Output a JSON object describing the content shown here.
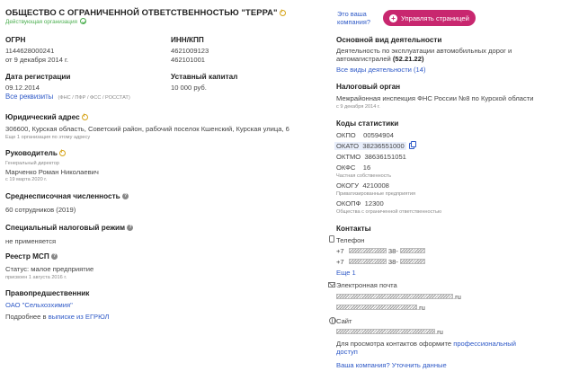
{
  "header": {
    "company_title": "ОБЩЕСТВО С ОГРАНИЧЕННОЙ ОТВЕТСТВЕННОСТЬЮ \"ТЕРРА\"",
    "status": "Действующая организация",
    "your_company_q": "Это ваша компания?",
    "manage_btn": "Управлять страницей"
  },
  "left": {
    "ogrn": {
      "label": "ОГРН",
      "value": "1144628000241",
      "sub": "от 9 декабря 2014 г."
    },
    "inn": {
      "label": "ИНН/КПП",
      "value1": "4621009123",
      "value2": "462101001"
    },
    "reg": {
      "label": "Дата регистрации",
      "value": "09.12.2014",
      "link": "Все реквизиты",
      "sub": "(ФНС / ПФР / ФСС / РОССТАТ)"
    },
    "capital": {
      "label": "Уставный капитал",
      "value": "10 000 руб."
    },
    "address": {
      "label": "Юридический адрес",
      "value": "306600, Курская область, Советский район, рабочий поселок Кшенский, Курская улица, 6",
      "sub": "Еще 1 организация по этому адресу"
    },
    "director": {
      "label": "Руководитель",
      "role": "Генеральный директор",
      "name": "Марченко Роман Николаевич",
      "since": "с 19 марта 2020 г."
    },
    "staff": {
      "label": "Среднесписочная численность",
      "value": "60 сотрудников (2019)"
    },
    "tax_regime": {
      "label": "Специальный налоговый режим",
      "value": "не применяется"
    },
    "msp": {
      "label": "Реестр МСП",
      "value": "Статус: малое предприятие",
      "sub": "присвоен 1 августа 2016 г."
    },
    "predecessor": {
      "label": "Правопредшественник",
      "value": "ОАО \"Сельхозхимия\"",
      "more_prefix": "Подробнее в",
      "more_link": "выписке из ЕГРЮЛ"
    }
  },
  "right": {
    "activity": {
      "label": "Основной вид деятельности",
      "value": "Деятельность по эксплуатации автомобильных дорог и автомагистралей",
      "code": "(52.21.22)",
      "link": "Все виды деятельности (14)"
    },
    "tax_org": {
      "label": "Налоговый орган",
      "value": "Межрайонная инспекция ФНС России №8 по Курской области",
      "sub": "с 9 декабря 2014 г."
    },
    "codes": {
      "label": "Коды статистики",
      "okpo_l": "ОКПО",
      "okpo_v": "00594904",
      "okato_l": "ОКАТО",
      "okato_v": "38236551000",
      "oktmo_l": "ОКТМО",
      "oktmo_v": "38636151051",
      "okfs_l": "ОКФС",
      "okfs_v": "16",
      "okfs_sub": "Частная собственность",
      "okogu_l": "ОКОГУ",
      "okogu_v": "4210008",
      "okogu_sub": "Приватизированные предприятия",
      "okopf_l": "ОКОПФ",
      "okopf_v": "12300",
      "okopf_sub": "Общества с ограниченной ответственностью"
    },
    "contacts": {
      "label": "Контакты",
      "phone_label": "Телефон",
      "phone1_prefix": "+7",
      "phone1_suffix": "38-",
      "phone2_prefix": "+7",
      "phone2_suffix": "38-",
      "phone_more": "Еще 1",
      "email_label": "Электронная почта",
      "email1_suffix": ".ru",
      "email2_suffix": ".ru",
      "site_label": "Сайт",
      "site_suffix": ".ru",
      "note_prefix": "Для просмотра контактов оформите",
      "note_link": "профессиональный доступ",
      "update_link": "Ваша компания? Уточнить данные"
    }
  },
  "colors": {
    "accent_link": "#2e59c7",
    "manage_button": "#c8276f",
    "active_status": "#4caf50"
  }
}
